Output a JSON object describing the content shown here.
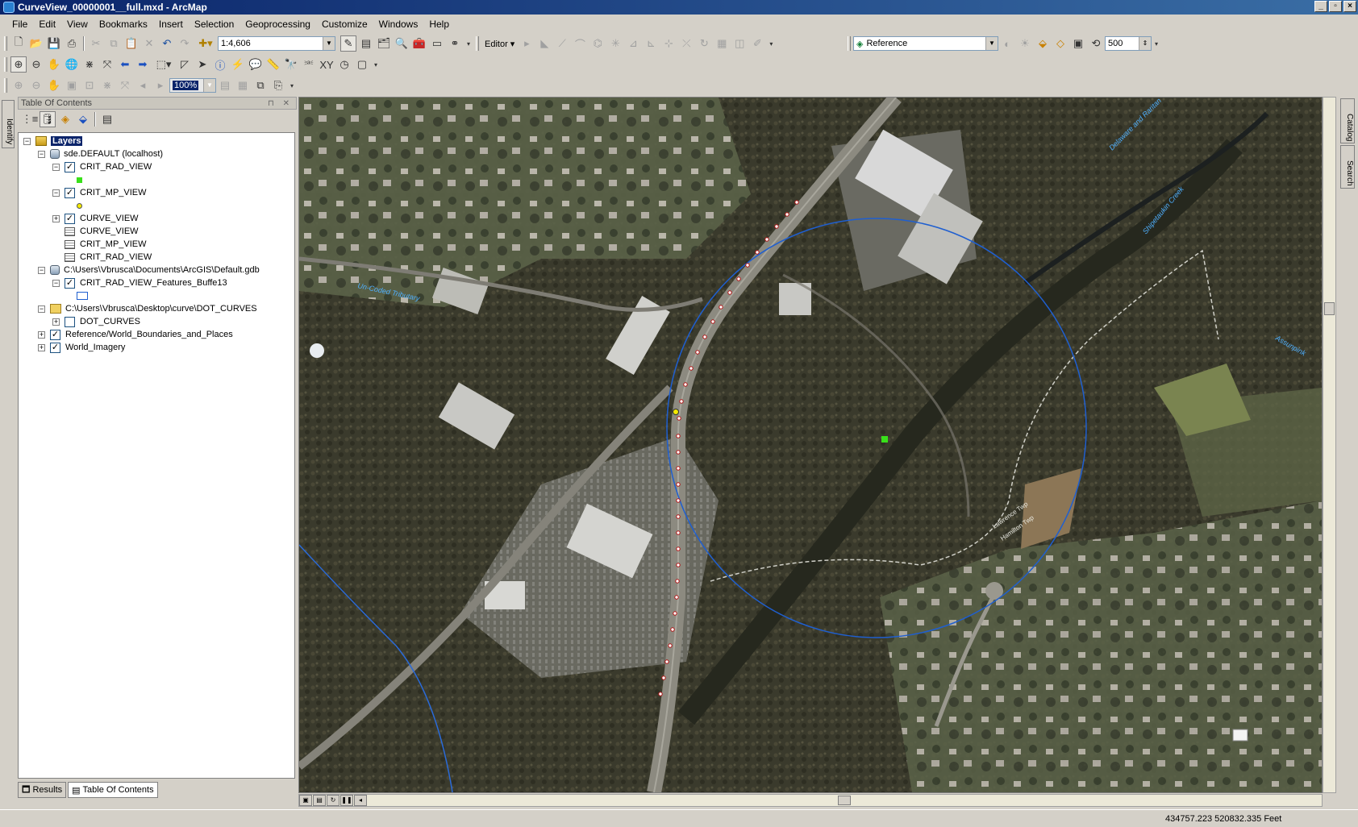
{
  "window": {
    "title": "CurveView_00000001__full.mxd - ArcMap"
  },
  "menu": [
    "File",
    "Edit",
    "View",
    "Bookmarks",
    "Insert",
    "Selection",
    "Geoprocessing",
    "Customize",
    "Windows",
    "Help"
  ],
  "toolbar": {
    "scale": "1:4,606",
    "editor_label": "Editor",
    "georef_layer": "Reference",
    "distance": "500",
    "zoom_percent": "100%"
  },
  "toc": {
    "title": "Table Of Contents",
    "root": "Layers",
    "items": [
      {
        "label": "sde.DEFAULT (localhost)"
      },
      {
        "label": "CRIT_RAD_VIEW",
        "checked": true
      },
      {
        "label": "CRIT_MP_VIEW",
        "checked": true
      },
      {
        "label": "CURVE_VIEW",
        "checked": true
      },
      {
        "label": "CURVE_VIEW"
      },
      {
        "label": "CRIT_MP_VIEW"
      },
      {
        "label": "CRIT_RAD_VIEW"
      },
      {
        "label": "C:\\Users\\Vbrusca\\Documents\\ArcGIS\\Default.gdb"
      },
      {
        "label": "CRIT_RAD_VIEW_Features_Buffe13",
        "checked": true
      },
      {
        "label": "C:\\Users\\Vbrusca\\Desktop\\curve\\DOT_CURVES"
      },
      {
        "label": "DOT_CURVES",
        "checked": false
      },
      {
        "label": "Reference/World_Boundaries_and_Places",
        "checked": true
      },
      {
        "label": "World_Imagery",
        "checked": true
      }
    ],
    "tabs": [
      "Results",
      "Table Of Contents"
    ]
  },
  "map": {
    "labels": {
      "tributary": "Un-Coded Tributary",
      "river": "Delaware and Raritan",
      "creek": "Shipetaukin Creek",
      "assunpink": "Assunpink",
      "lawrence": "Lawrence Twp",
      "hamilton": "Hamilton Twp"
    }
  },
  "dock": {
    "identify": "Identify",
    "catalog": "Catalog",
    "search": "Search"
  },
  "status": {
    "coordinates": "434757.223  520832.335 Feet"
  },
  "colors": {
    "buffer_circle": "#1f5fd0",
    "marker_green": "#39e01a",
    "marker_yellow": "#f4ea00"
  }
}
